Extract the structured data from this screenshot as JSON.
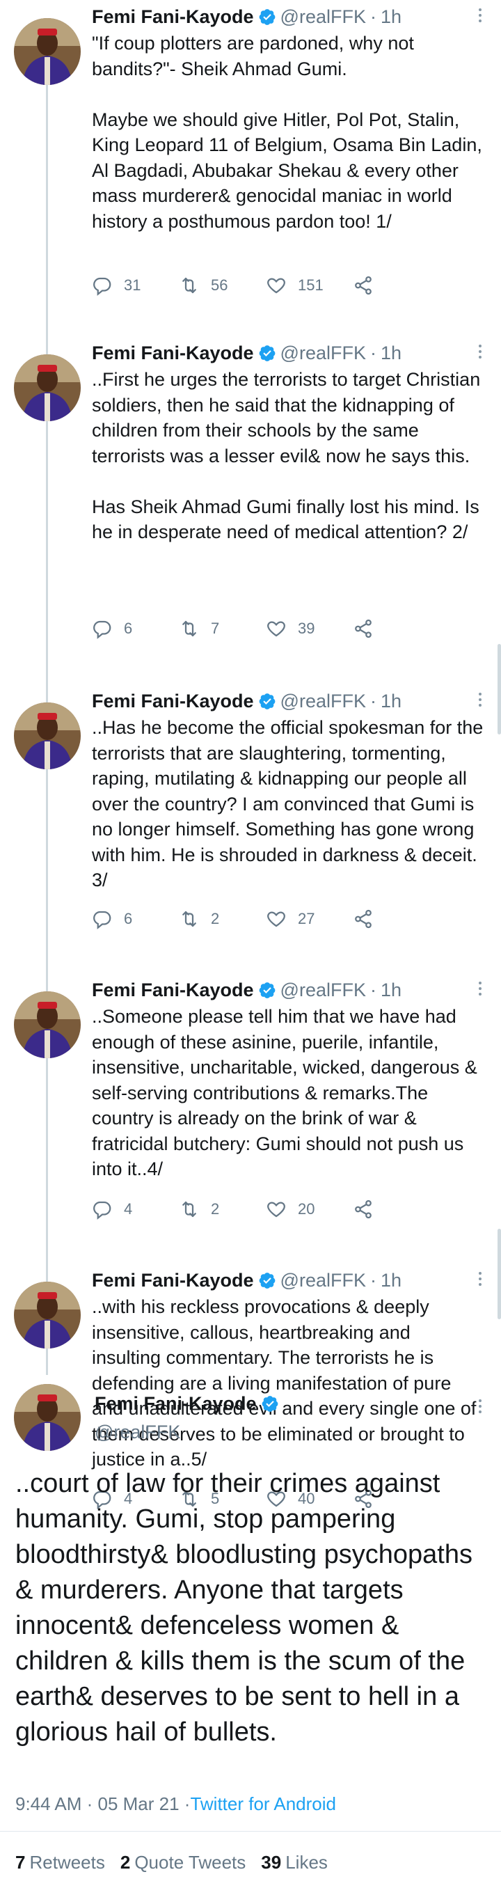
{
  "colors": {
    "accent": "#1da1f2",
    "muted": "#657786",
    "text": "#14171a",
    "thread_line": "#cfd9de"
  },
  "author": {
    "name": "Femi Fani-Kayode",
    "handle": "@realFFK",
    "verified_icon": "verified-badge-icon"
  },
  "thread": [
    {
      "time": "1h",
      "text": "\"If coup plotters are pardoned, why not bandits?\"- Sheik Ahmad Gumi.\n\nMaybe we should give Hitler, Pol Pot, Stalin, King Leopard 11 of Belgium, Osama Bin Ladin, Al Bagdadi, Abubakar Shekau & every other mass murderer& genocidal maniac in world history a posthumous pardon too! 1/",
      "replies": "31",
      "retweets": "56",
      "likes": "151"
    },
    {
      "time": "1h",
      "text": "..First he urges the terrorists to target Christian soldiers, then he said that the kidnapping of children from their schools by the same terrorists was a lesser evil& now he says this.\n\nHas Sheik Ahmad Gumi finally lost his mind. Is he in desperate need of medical attention? 2/",
      "replies": "6",
      "retweets": "7",
      "likes": "39"
    },
    {
      "time": "1h",
      "text": "..Has he become the official spokesman for the terrorists that are slaughtering, tormenting, raping, mutilating & kidnapping our people all over the country? I am convinced that Gumi is no longer himself. Something has gone wrong with him. He is shrouded in darkness & deceit. 3/",
      "replies": "6",
      "retweets": "2",
      "likes": "27"
    },
    {
      "time": "1h",
      "text": "..Someone please tell him that we have had enough of these asinine, puerile, infantile, insensitive, uncharitable, wicked, dangerous & self-serving contributions & remarks.The country is already on the brink of war & fratricidal butchery: Gumi should not push us into it..4/",
      "replies": "4",
      "retweets": "2",
      "likes": "20"
    },
    {
      "time": "1h",
      "text": "..with his reckless provocations & deeply insensitive, callous, heartbreaking and insulting commentary. The terrorists he is defending are a living manifestation of pure and unadulterated evil and every single one of them deserves to be eliminated or brought to justice in a..5/",
      "replies": "4",
      "retweets": "5",
      "likes": "40"
    }
  ],
  "main_tweet": {
    "text": "..court of law for their crimes against humanity. Gumi, stop pampering bloodthirsty& bloodlusting psychopaths & murderers. Anyone that targets innocent& defenceless women & children & kills them is the scum of the earth& deserves to be sent to hell in a glorious hail of bullets.",
    "timestamp": "9:44 AM · 05 Mar 21 · ",
    "source": "Twitter for Android",
    "retweets_count": "7",
    "retweets_label": "Retweets",
    "quotes_count": "2",
    "quotes_label": "Quote Tweets",
    "likes_count": "39",
    "likes_label": "Likes"
  }
}
